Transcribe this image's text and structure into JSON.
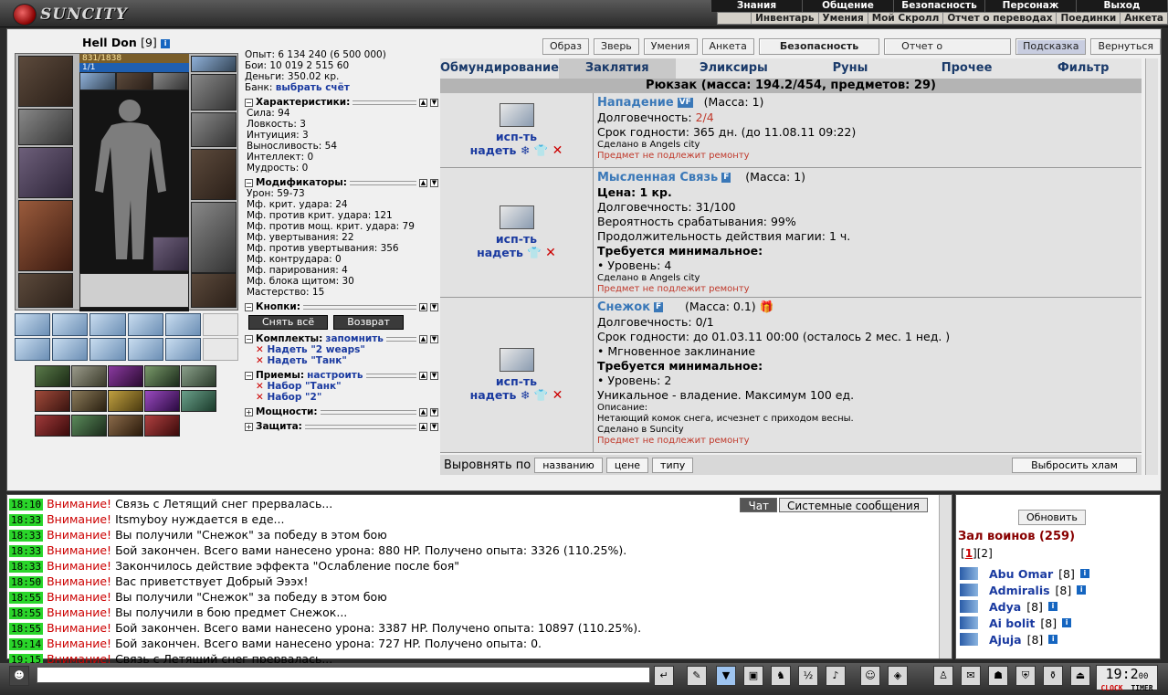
{
  "app": {
    "brand": "SUNCITY"
  },
  "top_menu": [
    "Знания",
    "Общение",
    "Безопасность",
    "Персонаж",
    "Выход"
  ],
  "sub_menu": [
    "Инвентарь",
    "Умения",
    "Мой Скролл",
    "Отчет о переводах",
    "Поединки",
    "Анкета"
  ],
  "character": {
    "name": "Hell Don",
    "level": "[9]",
    "hp": "831/1838",
    "mana": "1/1",
    "exp": "Опыт: 6 134 240 (6 500 000)",
    "fights": "Бои: 10 019 2 515 60",
    "money": "Деньги: 350.02 кр.",
    "bank_label": "Банк:",
    "bank_link": "выбрать счёт"
  },
  "characteristics": {
    "title": "Характеристики:",
    "lines": [
      "Сила: 94",
      "Ловкость: 3",
      "Интуиция: 3",
      "Выносливость: 54",
      "Интеллект: 0",
      "Мудрость: 0"
    ]
  },
  "modifiers": {
    "title": "Модификаторы:",
    "lines": [
      "Урон: 59-73",
      "Мф. крит. удара: 24",
      "Мф. против крит. удара: 121",
      "Мф. против мощ. крит. удара: 79",
      "Мф. увертывания: 22",
      "Мф. против увертывания: 356",
      "Мф. контрудара: 0",
      "Мф. парирования: 4",
      "Мф. блока щитом: 30",
      "Мастерство: 15"
    ]
  },
  "buttons_section": {
    "title": "Кнопки:",
    "remove_all": "Снять всё",
    "return": "Возврат"
  },
  "sets": {
    "title": "Комплекты:",
    "remember": "запомнить",
    "items": [
      "Надеть \"2 weaps\"",
      "Надеть \"Танк\""
    ]
  },
  "techniques": {
    "title": "Приемы:",
    "configure": "настроить",
    "items": [
      "Набор \"Танк\"",
      "Набор \"2\""
    ]
  },
  "powers": {
    "title": "Мощности:"
  },
  "defense": {
    "title": "Защита:"
  },
  "toolbar": [
    "Образ",
    "Зверь",
    "Умения",
    "Анкета",
    "Безопасность",
    "Отчет о переводах",
    "Подсказка",
    "Вернуться"
  ],
  "tabs": [
    "Обмундирование",
    "Заклятия",
    "Эликсиры",
    "Руны",
    "Прочее",
    "Фильтр"
  ],
  "backpack": "Рюкзак (масса: 194.2/454, предметов: 29)",
  "items": [
    {
      "use": "исп-ть",
      "wear": "надеть",
      "name": "Нападение",
      "badge": "VF",
      "mass": "(Масса: 1)",
      "lines": [
        "Долговечность: 2/4",
        "Срок годности: 365 дн. (до 11.08.11 09:22)"
      ],
      "made": "Сделано в Angels city",
      "norepair": "Предмет не подлежит ремонту"
    },
    {
      "use": "исп-ть",
      "wear": "надеть",
      "name": "Мысленная Связь",
      "badge": "F",
      "mass": "(Масса: 1)",
      "price": "Цена: 1 кр.",
      "lines": [
        "Долговечность: 31/100",
        "Вероятность срабатывания: 99%",
        "Продолжительность действия магии: 1 ч."
      ],
      "req_title": "Требуется минимальное:",
      "req": "• Уровень: 4",
      "made": "Сделано в Angels city",
      "norepair": "Предмет не подлежит ремонту"
    },
    {
      "use": "исп-ть",
      "wear": "надеть",
      "name": "Снежок",
      "badge": "F",
      "mass": "(Масса: 0.1)",
      "lines": [
        "Долговечность: 0/1",
        "Срок годности: до 01.03.11 00:00 (осталось 2 мес. 1 нед. )",
        "• Мгновенное заклинание"
      ],
      "req_title": "Требуется минимальное:",
      "req": "• Уровень: 2",
      "unique": "Уникальное - владение. Максимум 100 ед.",
      "desc_title": "Описание:",
      "desc": "Нетающий комок снега, исчезнет с приходом весны.",
      "made": "Сделано в Suncity",
      "norepair": "Предмет не подлежит ремонту"
    }
  ],
  "sort": {
    "label": "Выровнять по",
    "by_name": "названию",
    "by_price": "цене",
    "by_type": "типу",
    "junk": "Выбросить хлам"
  },
  "chat": {
    "tabs": [
      "Чат",
      "Системные сообщения"
    ],
    "messages": [
      {
        "time": "18:10",
        "warn": "Внимание!",
        "text": "Связь с Летящий снег прервалась..."
      },
      {
        "time": "18:33",
        "warn": "Внимание!",
        "text": "Itsmyboy нуждается в еде..."
      },
      {
        "time": "18:33",
        "warn": "Внимание!",
        "text": "Вы получили \"Снежок\" за победу в этом бою"
      },
      {
        "time": "18:33",
        "warn": "Внимание!",
        "text": "Бой закончен. Всего вами нанесено урона: 880 HP. Получено опыта: 3326 (110.25%)."
      },
      {
        "time": "18:33",
        "warn": "Внимание!",
        "text": "Закончилось действие эффекта \"Ослабление после боя\""
      },
      {
        "time": "18:50",
        "warn": "Внимание!",
        "text": "Вас приветствует Добрый Эээх!"
      },
      {
        "time": "18:55",
        "warn": "Внимание!",
        "text": "Вы получили \"Снежок\" за победу в этом бою"
      },
      {
        "time": "18:55",
        "warn": "Внимание!",
        "text": "Вы получили в бою предмет Снежок..."
      },
      {
        "time": "18:55",
        "warn": "Внимание!",
        "text": "Бой закончен. Всего вами нанесено урона: 3387 HP. Получено опыта: 10897 (110.25%)."
      },
      {
        "time": "19:14",
        "warn": "Внимание!",
        "text": "Бой закончен. Всего вами нанесено урона: 727 HP. Получено опыта: 0."
      },
      {
        "time": "19:15",
        "warn": "Внимание!",
        "text": "Связь с Летящий снег прервалась..."
      }
    ]
  },
  "hall": {
    "refresh": "Обновить",
    "title": "Зал воинов (259)",
    "page1": "1",
    "page2": "2",
    "players": [
      {
        "name": "Abu Omar",
        "level": "[8]"
      },
      {
        "name": "Admiralis",
        "level": "[8]"
      },
      {
        "name": "Adya",
        "level": "[8]"
      },
      {
        "name": "Ai bolit",
        "level": "[8]"
      },
      {
        "name": "Ajuja",
        "level": "[8]"
      }
    ]
  },
  "clock": {
    "time": "19:2",
    "sec": "00",
    "label1": "CLOCK",
    "label2": "TIMER"
  }
}
